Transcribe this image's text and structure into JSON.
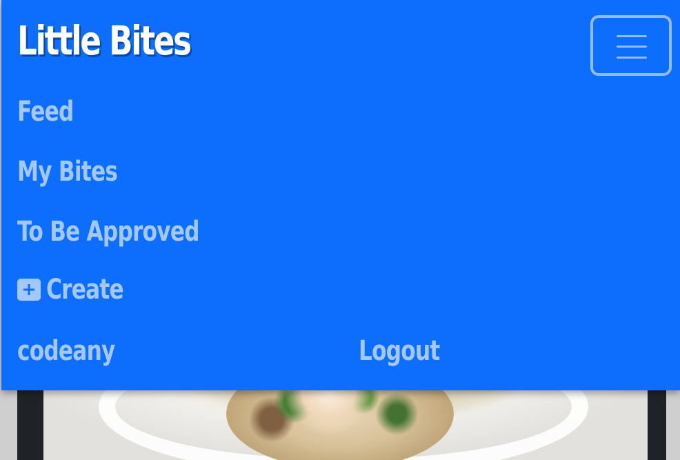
{
  "brand": {
    "title": "Little Bites"
  },
  "navbar": {
    "toggler_icon": "hamburger-icon",
    "links": {
      "feed": "Feed",
      "my_bites": "My Bites",
      "to_be_approved": "To Be Approved",
      "create": "Create",
      "create_icon": "plus-square-icon",
      "username": "codeany",
      "logout": "Logout"
    }
  },
  "content": {
    "card_image_subject": "food-image"
  },
  "colors": {
    "navbar_bg": "#0d6efd",
    "brand_text": "#ffffff",
    "link_text": "rgba(255,255,255,0.62)"
  }
}
